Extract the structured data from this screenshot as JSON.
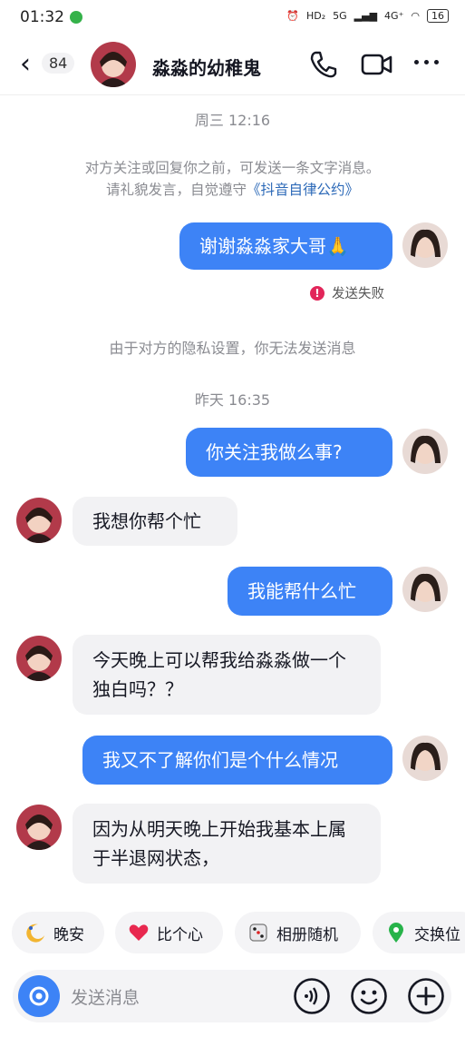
{
  "status": {
    "time": "01:32",
    "hd": "HD₂",
    "net1": "5G",
    "net2": "4G⁺",
    "battery": "16"
  },
  "header": {
    "back_count": "84",
    "title": "淼淼的幼稚鬼"
  },
  "timestamps": [
    "周三 12:16",
    "昨天 16:35"
  ],
  "notice": {
    "line1": "对方关注或回复你之前，可发送一条文字消息。",
    "line2_prefix": "请礼貌发言，自觉遵守",
    "line2_link": "《抖音自律公约》"
  },
  "messages": [
    {
      "dir": "out",
      "text": "谢谢淼淼家大哥🙏"
    },
    {
      "dir": "out",
      "text": "你关注我做么事?"
    },
    {
      "dir": "in",
      "text": "我想你帮个忙"
    },
    {
      "dir": "out",
      "text": "我能帮什么忙"
    },
    {
      "dir": "in",
      "text": "今天晚上可以帮我给淼淼做一个独白吗？？"
    },
    {
      "dir": "out",
      "text": "我又不了解你们是个什么情况"
    },
    {
      "dir": "in",
      "text": "因为从明天晚上开始我基本上属于半退网状态，"
    }
  ],
  "send_failed": "发送失败",
  "privacy_notice": "由于对方的隐私设置，你无法发送消息",
  "quick_chips": [
    {
      "label": "晚安",
      "icon": "moon-icon"
    },
    {
      "label": "比个心",
      "icon": "heart-icon"
    },
    {
      "label": "相册随机",
      "icon": "dice-icon"
    },
    {
      "label": "交换位",
      "icon": "location-pin-icon"
    }
  ],
  "input": {
    "placeholder": "发送消息"
  },
  "colors": {
    "accent": "#3d83f6",
    "error": "#e2265a",
    "link": "#2d6ab8"
  }
}
